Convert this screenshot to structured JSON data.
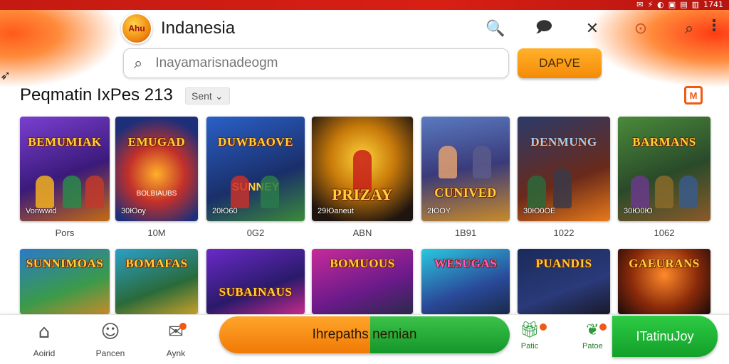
{
  "status_bar": [
    "✉",
    "⚡",
    "◐",
    "▣",
    "▤",
    "▥",
    "1741"
  ],
  "header": {
    "logo_text": "Ahu",
    "title": "Indanesia",
    "icons": [
      "search-zoom-icon",
      "chat-icon",
      "tools-icon",
      "trophy-icon"
    ]
  },
  "search": {
    "placeholder": "Inayamarisnadeogm",
    "button_label": "DAPVE"
  },
  "section": {
    "title": "Peqmatin IxPes 213",
    "sort_label": "Sent"
  },
  "games_row1": [
    {
      "title": "BEMUMIAK",
      "sub": "",
      "stat": "Vonwwid",
      "caption": "Pors"
    },
    {
      "title": "EMUGAD",
      "sub": "BOLBIAUBS",
      "stat": "30Юоу",
      "caption": "10M"
    },
    {
      "title": "DUWBAOVE",
      "sub": "SUNNEY",
      "stat": "20Ю60",
      "caption": "0G2"
    },
    {
      "title": "PRIZAY",
      "sub": "",
      "stat": "29Юaneut",
      "caption": "ABN"
    },
    {
      "title": "CUNIVED",
      "sub": "",
      "stat": "2ЮOY",
      "caption": "1B91"
    },
    {
      "title": "DENMUNG",
      "sub": "",
      "stat": "30Ю0OE",
      "caption": "1022"
    },
    {
      "title": "BARMANS",
      "sub": "",
      "stat": "30Ю0Ю",
      "caption": "1062"
    }
  ],
  "games_row2": [
    {
      "title": "SUNNIMOAS"
    },
    {
      "title": "BOMAFAS"
    },
    {
      "title": "SUBAINAUS"
    },
    {
      "title": "BOMUOUS"
    },
    {
      "title": "WESUGAS"
    },
    {
      "title": "PUANDIS"
    },
    {
      "title": "GAEURANS"
    }
  ],
  "bottom_nav": {
    "items": [
      {
        "label": "Aoirid",
        "icon": "home-icon"
      },
      {
        "label": "Pancen",
        "icon": "profile-icon"
      },
      {
        "label": "Aynk",
        "icon": "inbox-icon"
      }
    ],
    "big_button_label": "Ihrepaths nemian",
    "small_items": [
      {
        "label": "Patic",
        "icon": "gift-icon"
      },
      {
        "label": "Patoe",
        "icon": "leaf-icon"
      }
    ],
    "green_button_label": "ITatinuJoy"
  },
  "colors": {
    "brand_red": "#c41a12",
    "accent_orange": "#f58a06",
    "accent_green": "#14962a"
  }
}
